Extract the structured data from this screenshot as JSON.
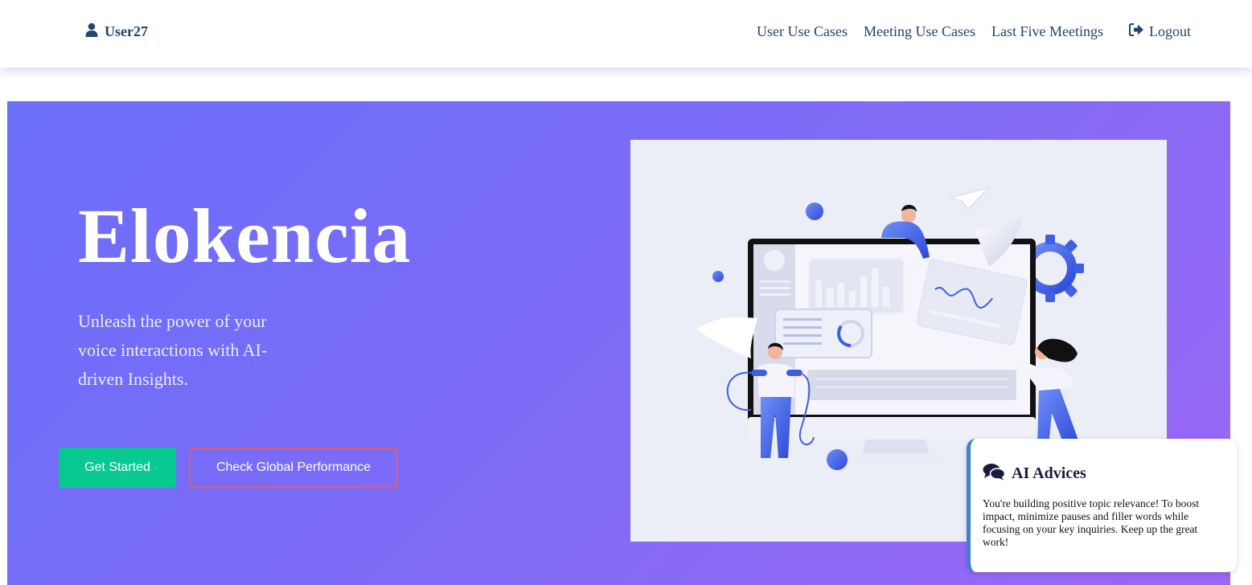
{
  "navbar": {
    "user": {
      "name": "User27",
      "icon": "user-icon"
    },
    "links": [
      {
        "label": "User Use Cases"
      },
      {
        "label": "Meeting Use Cases"
      },
      {
        "label": "Last Five Meetings"
      }
    ],
    "logout": {
      "label": "Logout",
      "icon": "sign-out-icon"
    }
  },
  "hero": {
    "title": "Elokencia",
    "subtitle": "Unleash the power of your voice interactions with AI-driven Insights.",
    "primary_button": "Get Started",
    "secondary_button": "Check Global Performance",
    "illustration": "analytics-team-illustration"
  },
  "advice": {
    "icon": "comments-icon",
    "title": "AI Advices",
    "text": "You're building positive topic relevance! To boost impact, minimize pauses and filler words while focusing on your key inquiries. Keep up the great work!"
  },
  "colors": {
    "nav_text": "#24456b",
    "gradient_start": "#6a6ef9",
    "gradient_end": "#9c68f5",
    "primary_button": "#08c98f",
    "outline_border": "#d9607a",
    "advice_accent": "#3d7fd1"
  }
}
